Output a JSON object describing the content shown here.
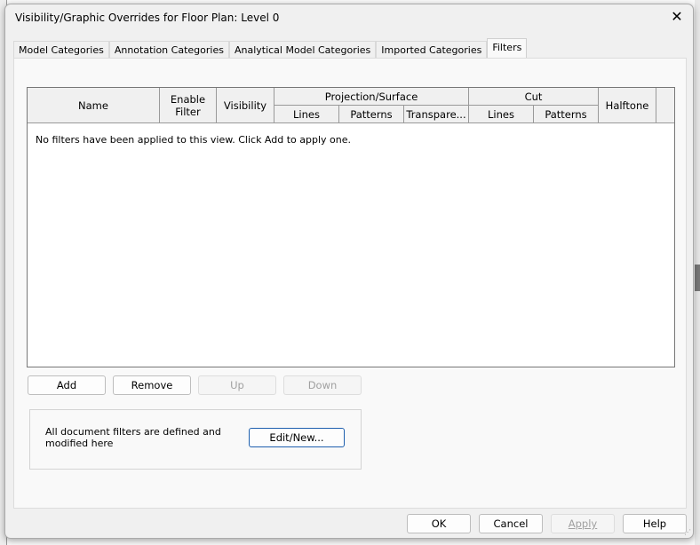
{
  "dialog": {
    "title": "Visibility/Graphic Overrides for Floor Plan: Level 0",
    "close_icon": "close-icon"
  },
  "tabs": [
    {
      "label": "Model Categories"
    },
    {
      "label": "Annotation Categories"
    },
    {
      "label": "Analytical Model Categories"
    },
    {
      "label": "Imported Categories"
    },
    {
      "label": "Filters",
      "active": true
    }
  ],
  "table": {
    "headers": {
      "name": "Name",
      "enable_filter": "Enable Filter",
      "visibility": "Visibility",
      "projection": "Projection/Surface",
      "proj_lines": "Lines",
      "proj_patterns": "Patterns",
      "proj_transparency": "Transpare...",
      "cut": "Cut",
      "cut_lines": "Lines",
      "cut_patterns": "Patterns",
      "halftone": "Halftone"
    },
    "empty_message": "No filters have been applied to this view. Click Add to apply one."
  },
  "row_buttons": {
    "add": "Add",
    "remove": "Remove",
    "up": "Up",
    "down": "Down"
  },
  "filters_group": {
    "text": "All document filters are defined and modified here",
    "edit_new": "Edit/New..."
  },
  "footer": {
    "ok": "OK",
    "cancel": "Cancel",
    "apply": "Apply",
    "help": "Help"
  }
}
